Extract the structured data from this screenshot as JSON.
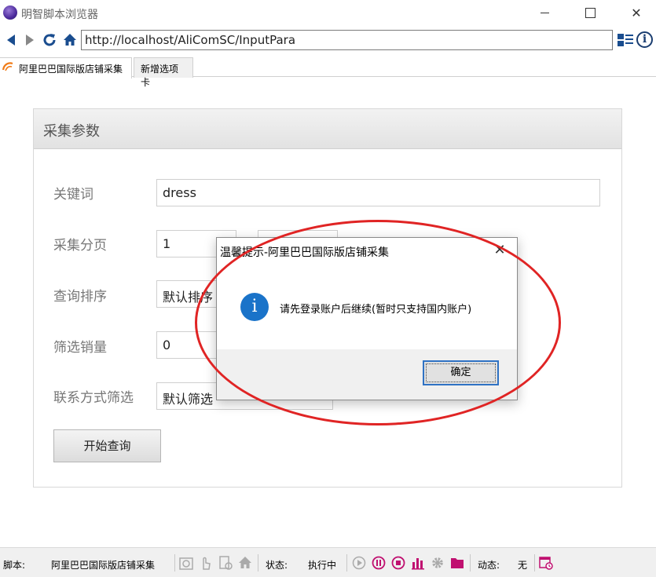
{
  "window": {
    "title": "明智脚本浏览器",
    "close_glyph": "✕"
  },
  "navbar": {
    "url": "http://localhost/AliComSC/InputPara",
    "info_glyph": "i"
  },
  "tabs": [
    {
      "label": "阿里巴巴国际版店铺采集",
      "active": true
    },
    {
      "label": "新增选项卡",
      "active": false
    }
  ],
  "panel": {
    "title": "采集参数",
    "fields": [
      {
        "label": "关键词",
        "value": "dress"
      },
      {
        "label": "采集分页",
        "value": "1"
      },
      {
        "label": "查询排序",
        "value": "默认排序"
      },
      {
        "label": "筛选销量",
        "value": "0"
      },
      {
        "label": "联系方式筛选",
        "value": "默认筛选"
      }
    ],
    "start_button": "开始查询"
  },
  "dialog": {
    "title": "温馨提示-阿里巴巴国际版店铺采集",
    "close_glyph": "✕",
    "icon_glyph": "i",
    "message": "请先登录账户后继续(暂时只支持国内账户)",
    "ok_label": "确定"
  },
  "statusbar": {
    "script_label": "脚本:",
    "script_name": "阿里巴巴国际版店铺采集",
    "state_label": "状态:",
    "state_value": "执行中",
    "dynamic_label": "动态:",
    "dynamic_value": "无"
  },
  "colors": {
    "accent": "#1a4d8f",
    "dialog_icon": "#1a73c9",
    "annotation": "#e02424",
    "status_icons": "#c01070"
  }
}
